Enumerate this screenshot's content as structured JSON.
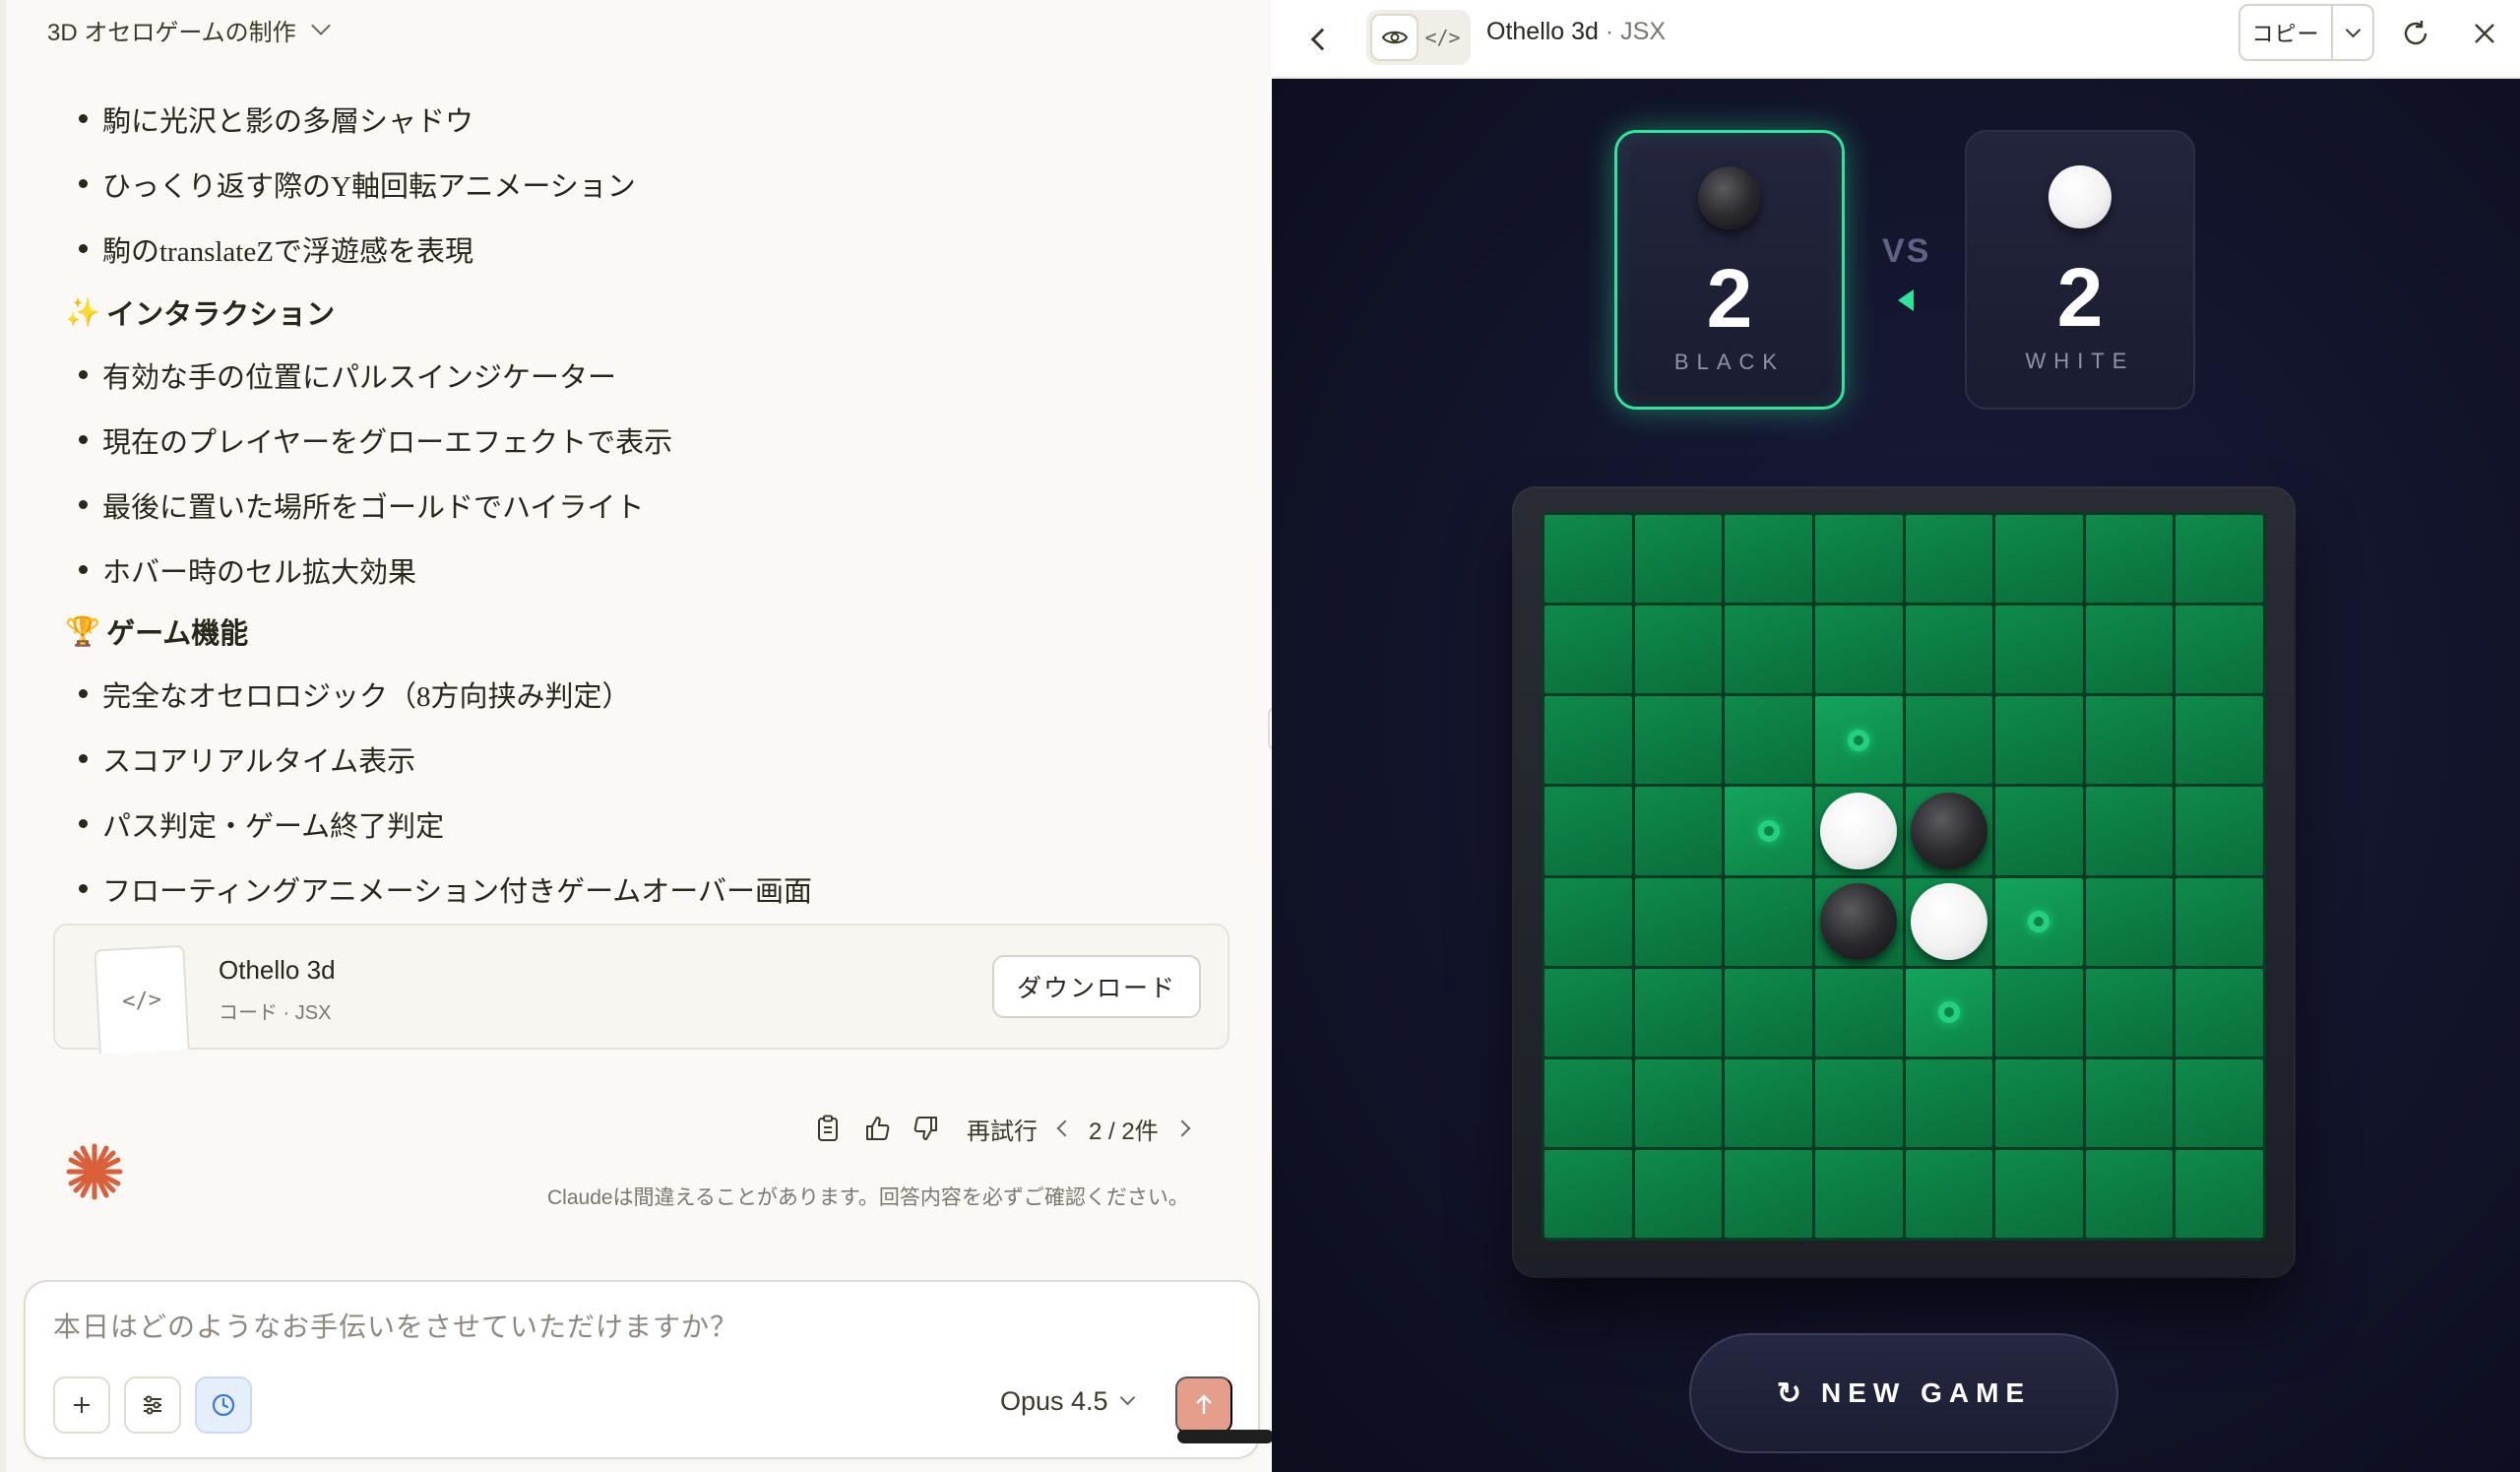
{
  "chat": {
    "title": "3D オセロゲームの制作",
    "bullets_1": [
      "駒に光沢と影の多層シャドウ",
      "ひっくり返す際のY軸回転アニメーション",
      "駒のtranslateZで浮遊感を表現"
    ],
    "section_interaction": {
      "emoji": "✨",
      "label": "インタラクション"
    },
    "bullets_2": [
      "有効な手の位置にパルスインジケーター",
      "現在のプレイヤーをグローエフェクトで表示",
      "最後に置いた場所をゴールドでハイライト",
      "ホバー時のセル拡大効果"
    ],
    "section_game": {
      "emoji": "🏆",
      "label": "ゲーム機能"
    },
    "bullets_3": [
      "完全なオセロロジック（8方向挟み判定）",
      "スコアリアルタイム表示",
      "パス判定・ゲーム終了判定",
      "フローティングアニメーション付きゲームオーバー画面"
    ],
    "artifact": {
      "name": "Othello 3d",
      "meta": "コード · JSX",
      "download_label": "ダウンロード",
      "thumb_icon": "</>"
    },
    "actions": {
      "retry_label": "再試行",
      "pager": "2 / 2件"
    },
    "disclaimer": "Claudeは間違えることがあります。回答内容を必ずご確認ください。",
    "composer": {
      "placeholder": "本日はどのようなお手伝いをさせていただけますか？",
      "model": "Opus 4.5"
    }
  },
  "artifact_panel": {
    "title": "Othello 3d",
    "subtitle": " · JSX",
    "toggle_code_icon": "</>",
    "copy_label": "コピー"
  },
  "game": {
    "vs_label": "VS",
    "black": {
      "score": "2",
      "label": "BLACK"
    },
    "white": {
      "score": "2",
      "label": "WHITE"
    },
    "current_player": "black",
    "new_game_icon": "↻",
    "new_game_label": "NEW GAME",
    "board": [
      "........",
      "........",
      "...*....",
      "..*WB...",
      "...BW*..",
      "....*...",
      "........",
      "........"
    ],
    "accent_color": "#2ee59a"
  }
}
